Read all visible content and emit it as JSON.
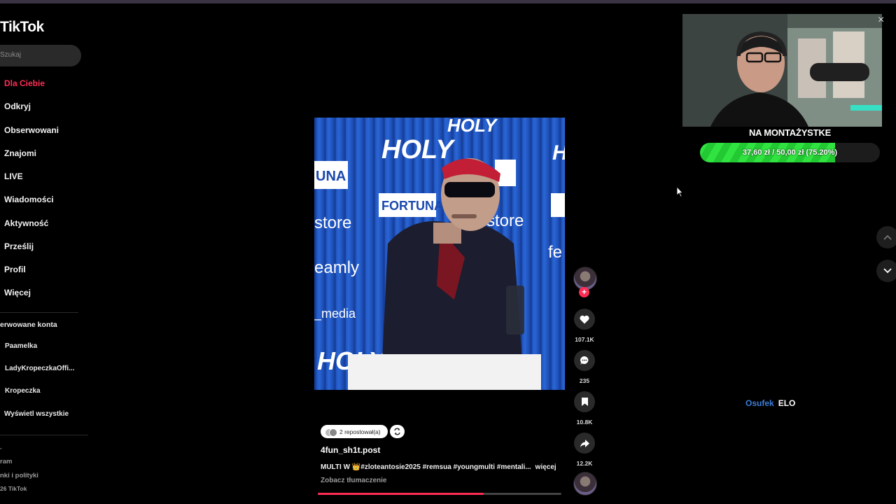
{
  "app": {
    "logo": "TikTok"
  },
  "search": {
    "placeholder": "Szukaj"
  },
  "sidebar": {
    "items": [
      {
        "label": "Dla Ciebie",
        "active": true
      },
      {
        "label": "Odkryj"
      },
      {
        "label": "Obserwowani"
      },
      {
        "label": "Znajomi"
      },
      {
        "label": "LIVE"
      },
      {
        "label": "Wiadomości"
      },
      {
        "label": "Aktywność"
      },
      {
        "label": "Prześlij"
      },
      {
        "label": "Profil"
      },
      {
        "label": "Więcej"
      }
    ],
    "following_title": "erwowane konta",
    "accounts": [
      "Paamelka",
      "LadyKropeczkaOffi...",
      "Kropeczka",
      "Wyświetl wszystkie"
    ],
    "footer": [
      "ram",
      "nki i polityki",
      "26 TikTok"
    ]
  },
  "video": {
    "repost_label": "2 repostował(a)",
    "author": "4fun_sh1t.post",
    "description": "MULTI W 👑#zloteantosie2025 #remsua #youngmulti #mentali...",
    "more_label": "więcej",
    "translate_label": "Zobacz tłumaczenie",
    "progress": 0.68,
    "brand_text": {
      "holy": "HOLY",
      "fortuna": "FORTUNA",
      "store": "store",
      "fe": "fe",
      "famly": "eamly",
      "media": "_media",
      "una": "UNA"
    }
  },
  "actions": {
    "likes": "107.1K",
    "comments": "235",
    "saves": "10.8K",
    "shares": "12.2K"
  },
  "stream": {
    "goal_title": "NA MONTAŻYSTKE",
    "goal_text": "37,60 zł / 50,00 zł (75.20%)",
    "goal_progress": 0.752,
    "chat_user": "Osufek",
    "chat_message": "ELO"
  },
  "colors": {
    "accent": "#fe2c55",
    "goal": "#31e340",
    "chat_user": "#3d7fd9"
  }
}
